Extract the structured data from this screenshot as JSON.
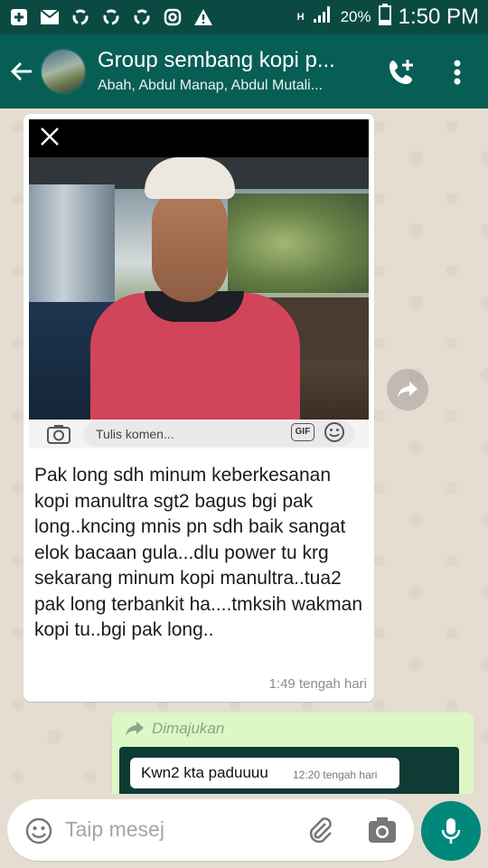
{
  "status_bar": {
    "network": "H",
    "battery": "20%",
    "time": "1:50 PM",
    "icons": [
      "plus-square-icon",
      "mail-icon",
      "recycle-icon",
      "recycle-icon",
      "recycle-icon",
      "instagram-icon",
      "warning-icon",
      "signal-icon",
      "battery-icon"
    ]
  },
  "header": {
    "title": "Group sembang kopi p...",
    "subtitle": "Abah, Abdul Manap, Abdul Mutali...",
    "colors": {
      "bar": "#075e54",
      "status": "#0a4a43"
    }
  },
  "message_in": {
    "comment_placeholder": "Tulis komen...",
    "gif_label": "GIF",
    "text": "Pak long sdh minum keberkesanan kopi manultra sgt2 bagus bgi pak long..kncing mnis pn sdh baik sangat elok bacaan gula...dlu power tu krg sekarang minum kopi manultra..tua2 pak long terbankit ha....tmksih wakman kopi tu..bgi pak long..",
    "time": "1:49 tengah hari"
  },
  "message_out": {
    "forwarded_label": "Dimajukan",
    "inner_text": "Kwn2 kta paduuuu",
    "inner_time": "12:20 tengah hari",
    "color": "#dcf8c6"
  },
  "composer": {
    "placeholder": "Taip mesej",
    "mic_color": "#00897b"
  }
}
